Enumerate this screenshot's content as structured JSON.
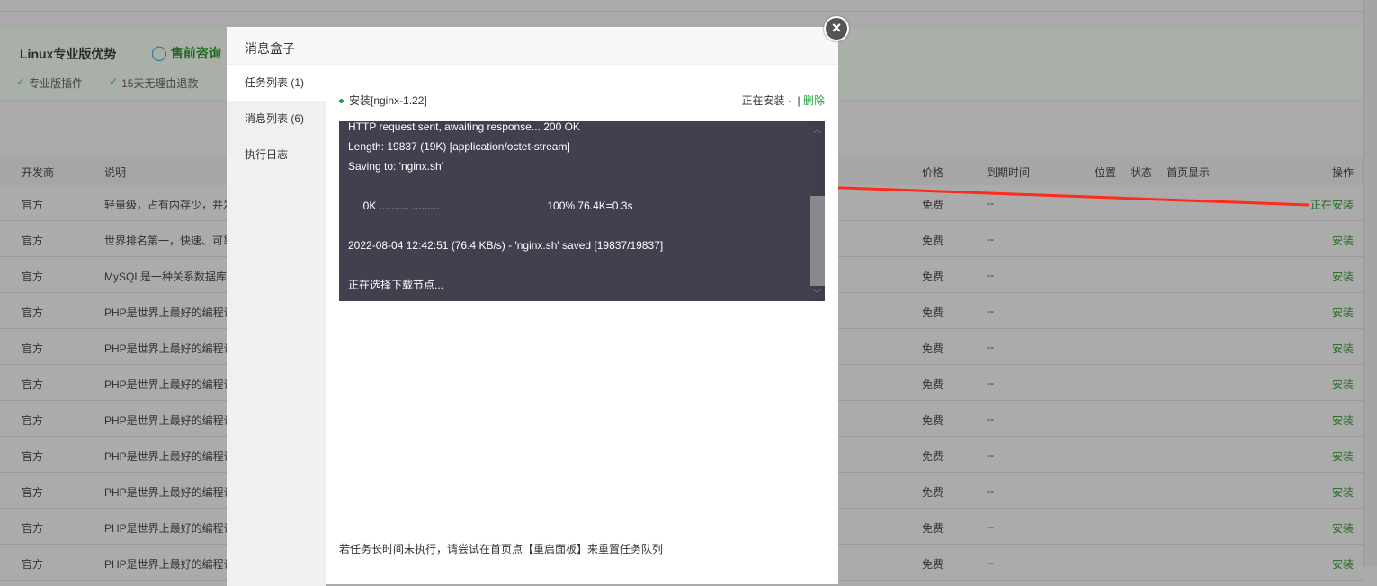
{
  "banner": {
    "title": "Linux专业版优势",
    "consult": "售前咨询",
    "features": [
      "专业版插件",
      "15天无理由退款"
    ]
  },
  "table": {
    "headers": {
      "developer": "开发商",
      "description": "说明",
      "price": "价格",
      "expire": "到期时间",
      "location": "位置",
      "status": "状态",
      "homepage": "首页显示",
      "action": "操作"
    },
    "rows": [
      {
        "developer": "官方",
        "description": "轻量级，占有内存少，并发",
        "price": "免费",
        "expire": "--",
        "action": "正在安装"
      },
      {
        "developer": "官方",
        "description": "世界排名第一，快速、可靠",
        "price": "免费",
        "expire": "--",
        "action": "安装"
      },
      {
        "developer": "官方",
        "description": "MySQL是一种关系数据库",
        "price": "免费",
        "expire": "--",
        "action": "安装"
      },
      {
        "developer": "官方",
        "description": "PHP是世界上最好的编程语言",
        "price": "免费",
        "expire": "--",
        "action": "安装"
      },
      {
        "developer": "官方",
        "description": "PHP是世界上最好的编程语言",
        "price": "免费",
        "expire": "--",
        "action": "安装"
      },
      {
        "developer": "官方",
        "description": "PHP是世界上最好的编程语言",
        "price": "免费",
        "expire": "--",
        "action": "安装"
      },
      {
        "developer": "官方",
        "description": "PHP是世界上最好的编程语言",
        "price": "免费",
        "expire": "--",
        "action": "安装"
      },
      {
        "developer": "官方",
        "description": "PHP是世界上最好的编程语言",
        "price": "免费",
        "expire": "--",
        "action": "安装"
      },
      {
        "developer": "官方",
        "description": "PHP是世界上最好的编程语言",
        "price": "免费",
        "expire": "--",
        "action": "安装"
      },
      {
        "developer": "官方",
        "description": "PHP是世界上最好的编程语言",
        "price": "免费",
        "expire": "--",
        "action": "安装"
      },
      {
        "developer": "官方",
        "description": "PHP是世界上最好的编程语言",
        "price": "免费",
        "expire": "--",
        "action": "安装"
      }
    ]
  },
  "modal": {
    "title": "消息盒子",
    "close": "×",
    "tabs": [
      "任务列表 (1)",
      "消息列表 (6)",
      "执行日志"
    ],
    "task": {
      "name": "安装[nginx-1.22]",
      "status": "正在安装 ·",
      "delete": "删除"
    },
    "log": [
      "HTTP request sent, awaiting response... 200 OK",
      "Length: 19837 (19K) [application/octet-stream]",
      "Saving to: 'nginx.sh'",
      "",
      "     0K .......... .........                                    100% 76.4K=0.3s",
      "",
      "2022-08-04 12:42:51 (76.4 KB/s) - 'nginx.sh' saved [19837/19837]",
      "",
      "正在选择下载节点..."
    ],
    "hint": "若任务长时间未执行，请尝试在首页点【重启面板】来重置任务队列"
  },
  "colors": {
    "accent": "#20a53a",
    "arrow": "#ff2a1a",
    "log_bg": "#41404f"
  }
}
